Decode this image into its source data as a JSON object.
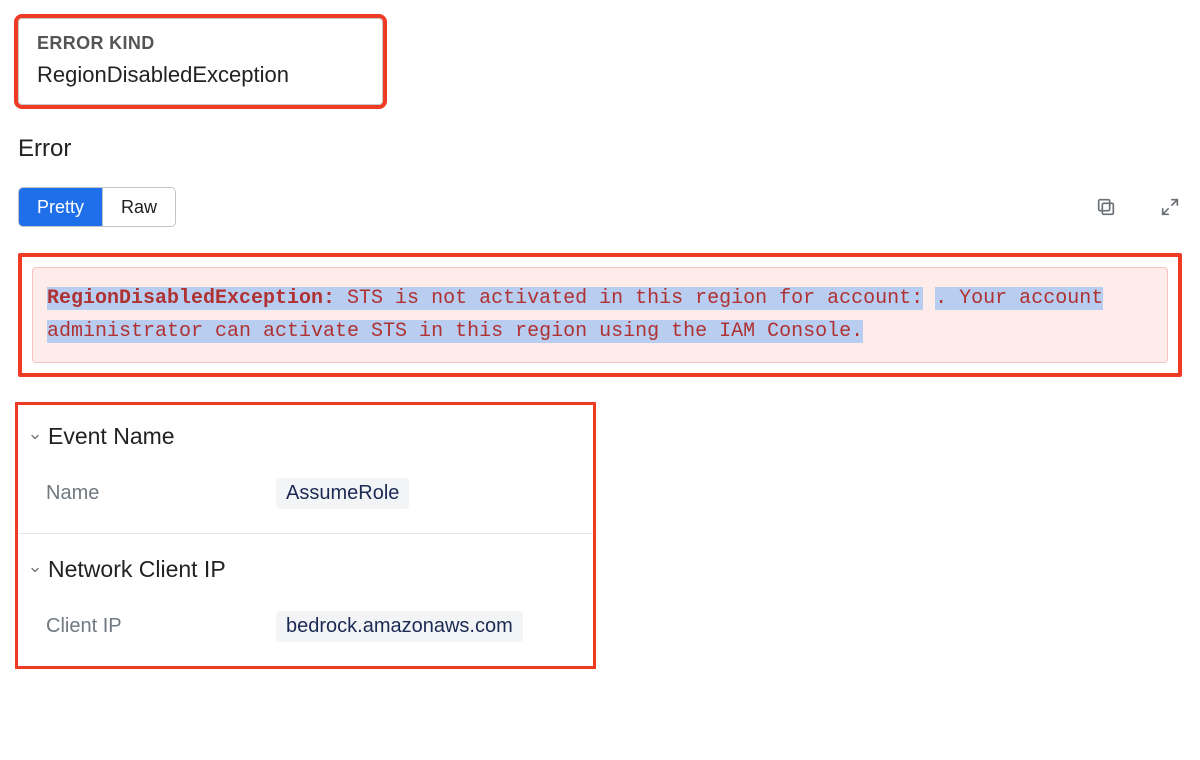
{
  "error_kind": {
    "label": "ERROR KIND",
    "value": "RegionDisabledException"
  },
  "error_heading": "Error",
  "viewer": {
    "tabs": {
      "pretty": "Pretty",
      "raw": "Raw"
    },
    "active": "pretty",
    "message": {
      "exception_name": "RegionDisabledException:",
      "body_part1": " STS is not activated in this region for account:",
      "account_gap": "            ",
      "body_part2": ". Your account administrator can activate STS in this region using the IAM Console."
    }
  },
  "details": {
    "event_name": {
      "title": "Event Name",
      "rows": [
        {
          "key": "Name",
          "value": "AssumeRole"
        }
      ]
    },
    "network_client_ip": {
      "title": "Network Client IP",
      "rows": [
        {
          "key": "Client IP",
          "value": "bedrock.amazonaws.com"
        }
      ]
    }
  }
}
